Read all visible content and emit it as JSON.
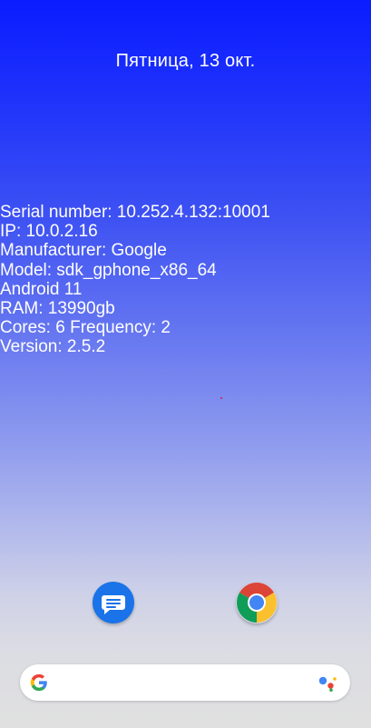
{
  "lockscreen": {
    "date": "Пятница, 13 окт."
  },
  "device_info": {
    "lines": [
      "Serial number: 10.252.4.132:10001",
      "IP: 10.0.2.16",
      "Manufacturer: Google",
      "Model: sdk_gphone_x86_64",
      "Android 11",
      "RAM: 13990gb",
      "Cores: 6 Frequency: 2",
      "Version: 2.5.2"
    ]
  },
  "dock": {
    "apps": [
      {
        "icon": "messages-icon"
      },
      {
        "icon": "chrome-icon"
      }
    ]
  },
  "search": {
    "icon": "google-g-icon",
    "assistant_icon": "google-assistant-icon"
  },
  "colors": {
    "top": "#0b1cff",
    "bottom": "#e0e0e0",
    "messages_blue": "#1a73e8"
  }
}
